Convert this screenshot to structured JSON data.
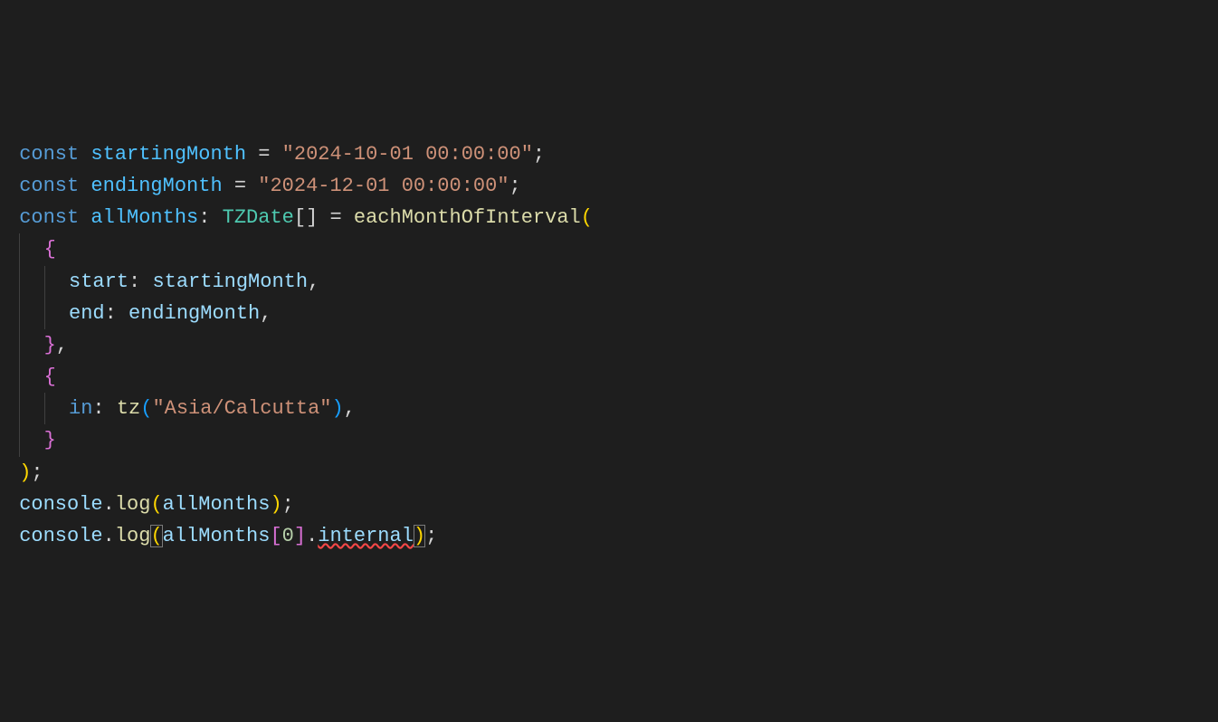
{
  "code": {
    "l1": {
      "kw": "const",
      "name": "startingMonth",
      "eq": " = ",
      "q": "\"",
      "val": "2024-10-01 00:00:00",
      "semi": ";"
    },
    "l2": {
      "kw": "const",
      "name": "endingMonth",
      "eq": " = ",
      "q": "\"",
      "val": "2024-12-01 00:00:00",
      "semi": ";"
    },
    "l3": {
      "kw": "const",
      "name": "allMonths",
      "colon": ": ",
      "type": "TZDate",
      "arr": "[]",
      "eq2": " = ",
      "fn": "eachMonthOfInterval",
      "open": "("
    },
    "l4": {
      "brace": "{"
    },
    "l5": {
      "key": "start",
      "colon": ":",
      "val": "startingMonth",
      "comma": ","
    },
    "l6": {
      "key": "end",
      "colon": ":",
      "val": "endingMonth",
      "comma": ","
    },
    "l7": {
      "brace": "}",
      "comma": ","
    },
    "l8": {
      "brace": "{"
    },
    "l9": {
      "kw": "in",
      "colon": ": ",
      "fn": "tz",
      "open": "(",
      "q": "\"",
      "val": "Asia/Calcutta",
      "close": ")",
      "comma": ","
    },
    "l10": {
      "brace": "}"
    },
    "l11": {
      "close": ")",
      "semi": ";"
    },
    "l12": {
      "obj": "console",
      "dot": ".",
      "fn": "log",
      "open": "(",
      "arg": "allMonths",
      "close": ")",
      "semi": ";"
    },
    "l13": {
      "obj": "console",
      "dot": ".",
      "fn": "log",
      "open": "(",
      "arg": "allMonths",
      "lb": "[",
      "idx": "0",
      "rb": "]",
      "dot2": ".",
      "prop": "internal",
      "close": ")",
      "semi": ";"
    }
  }
}
